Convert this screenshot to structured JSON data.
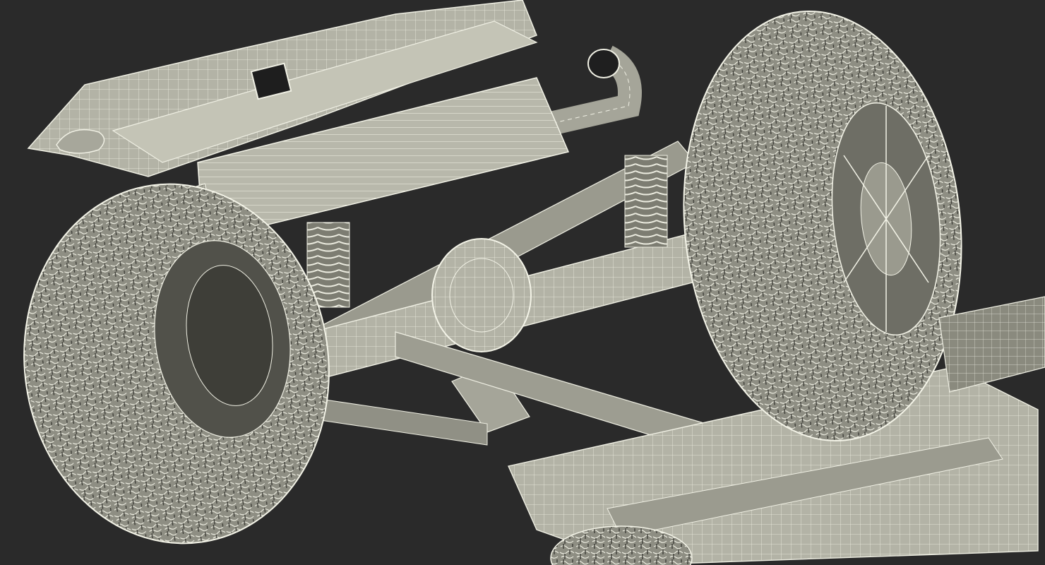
{
  "scene": {
    "subject": "truck-underbody-wireframe",
    "render_style": "wireframe",
    "colors": {
      "background": "#2a2a2a",
      "surface_light": "#b9b9ac",
      "surface_mid": "#9c9c90",
      "surface_dark": "#6f6f66",
      "shadow": "#4a4a44",
      "wire": "#f2f2e6"
    },
    "components": [
      "left-tire",
      "right-tire",
      "rear-bumper",
      "muffler",
      "exhaust-pipe",
      "rear-axle",
      "differential",
      "coil-spring-left",
      "coil-spring-right",
      "trailing-arm",
      "frame-crossmember",
      "driveshaft",
      "tow-hook",
      "spare-tire",
      "fuel-tank-skid-plate",
      "right-wheel-rim"
    ]
  }
}
